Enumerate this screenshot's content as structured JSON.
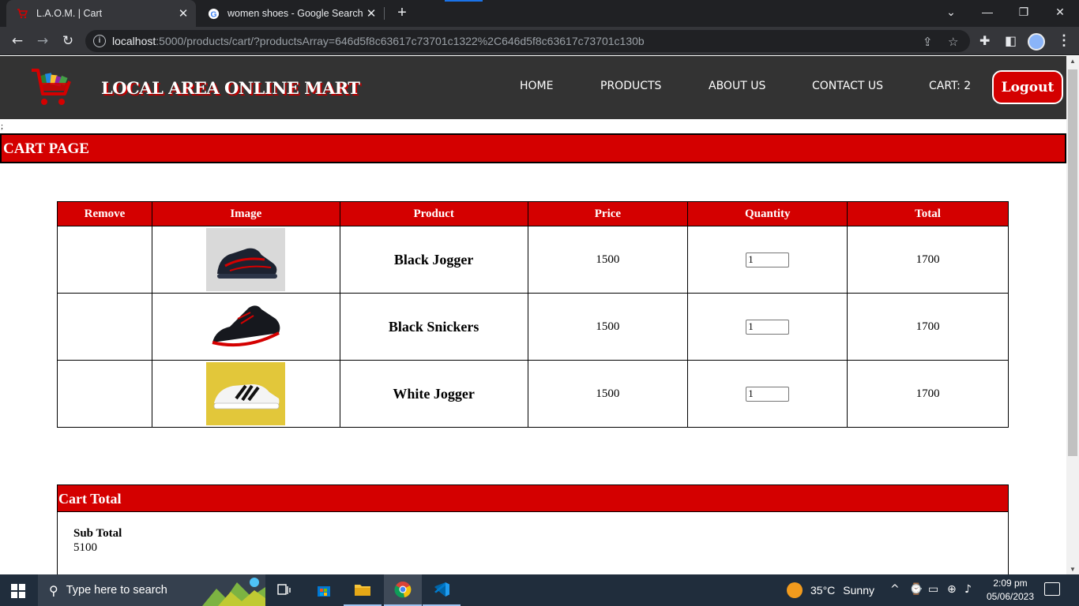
{
  "browser": {
    "tabs": [
      {
        "title": "L.A.O.M. | Cart",
        "active": true
      },
      {
        "title": "women shoes - Google Search",
        "active": false
      }
    ],
    "url_host": "localhost",
    "url_rest": ":5000/products/cart/?productsArray=646d5f8c63617c73701c1322%2C646d5f8c63617c73701c130b"
  },
  "site": {
    "brand": "LOCAL AREA ONLINE MART",
    "nav": [
      "HOME",
      "PRODUCTS",
      "ABOUT US",
      "CONTACT US",
      "CART: 2"
    ],
    "logout_label": "Logout",
    "stray_text": ";"
  },
  "cart": {
    "banner": "CART PAGE",
    "columns": [
      "Remove",
      "Image",
      "Product",
      "Price",
      "Quantity",
      "Total"
    ],
    "rows": [
      {
        "product": "Black Jogger",
        "price": "1500",
        "quantity": "1",
        "total": "1700",
        "image": "black-red-jogger-shoe"
      },
      {
        "product": "Black Snickers",
        "price": "1500",
        "quantity": "1",
        "total": "1700",
        "image": "black-red-sneaker-shoe"
      },
      {
        "product": "White Jogger",
        "price": "1500",
        "quantity": "1",
        "total": "1700",
        "image": "white-jogger-yellow-background"
      }
    ]
  },
  "totals": {
    "heading": "Cart Total",
    "subtotal_label": "Sub Total",
    "subtotal_value": "5100"
  },
  "taskbar": {
    "search_placeholder": "Type here to search",
    "temperature": "35°C",
    "weather": "Sunny",
    "time": "2:09 pm",
    "date": "05/06/2023"
  },
  "colors": {
    "accent_red": "#d40000",
    "header_bg": "#333333",
    "chrome_bg": "#35363a"
  }
}
